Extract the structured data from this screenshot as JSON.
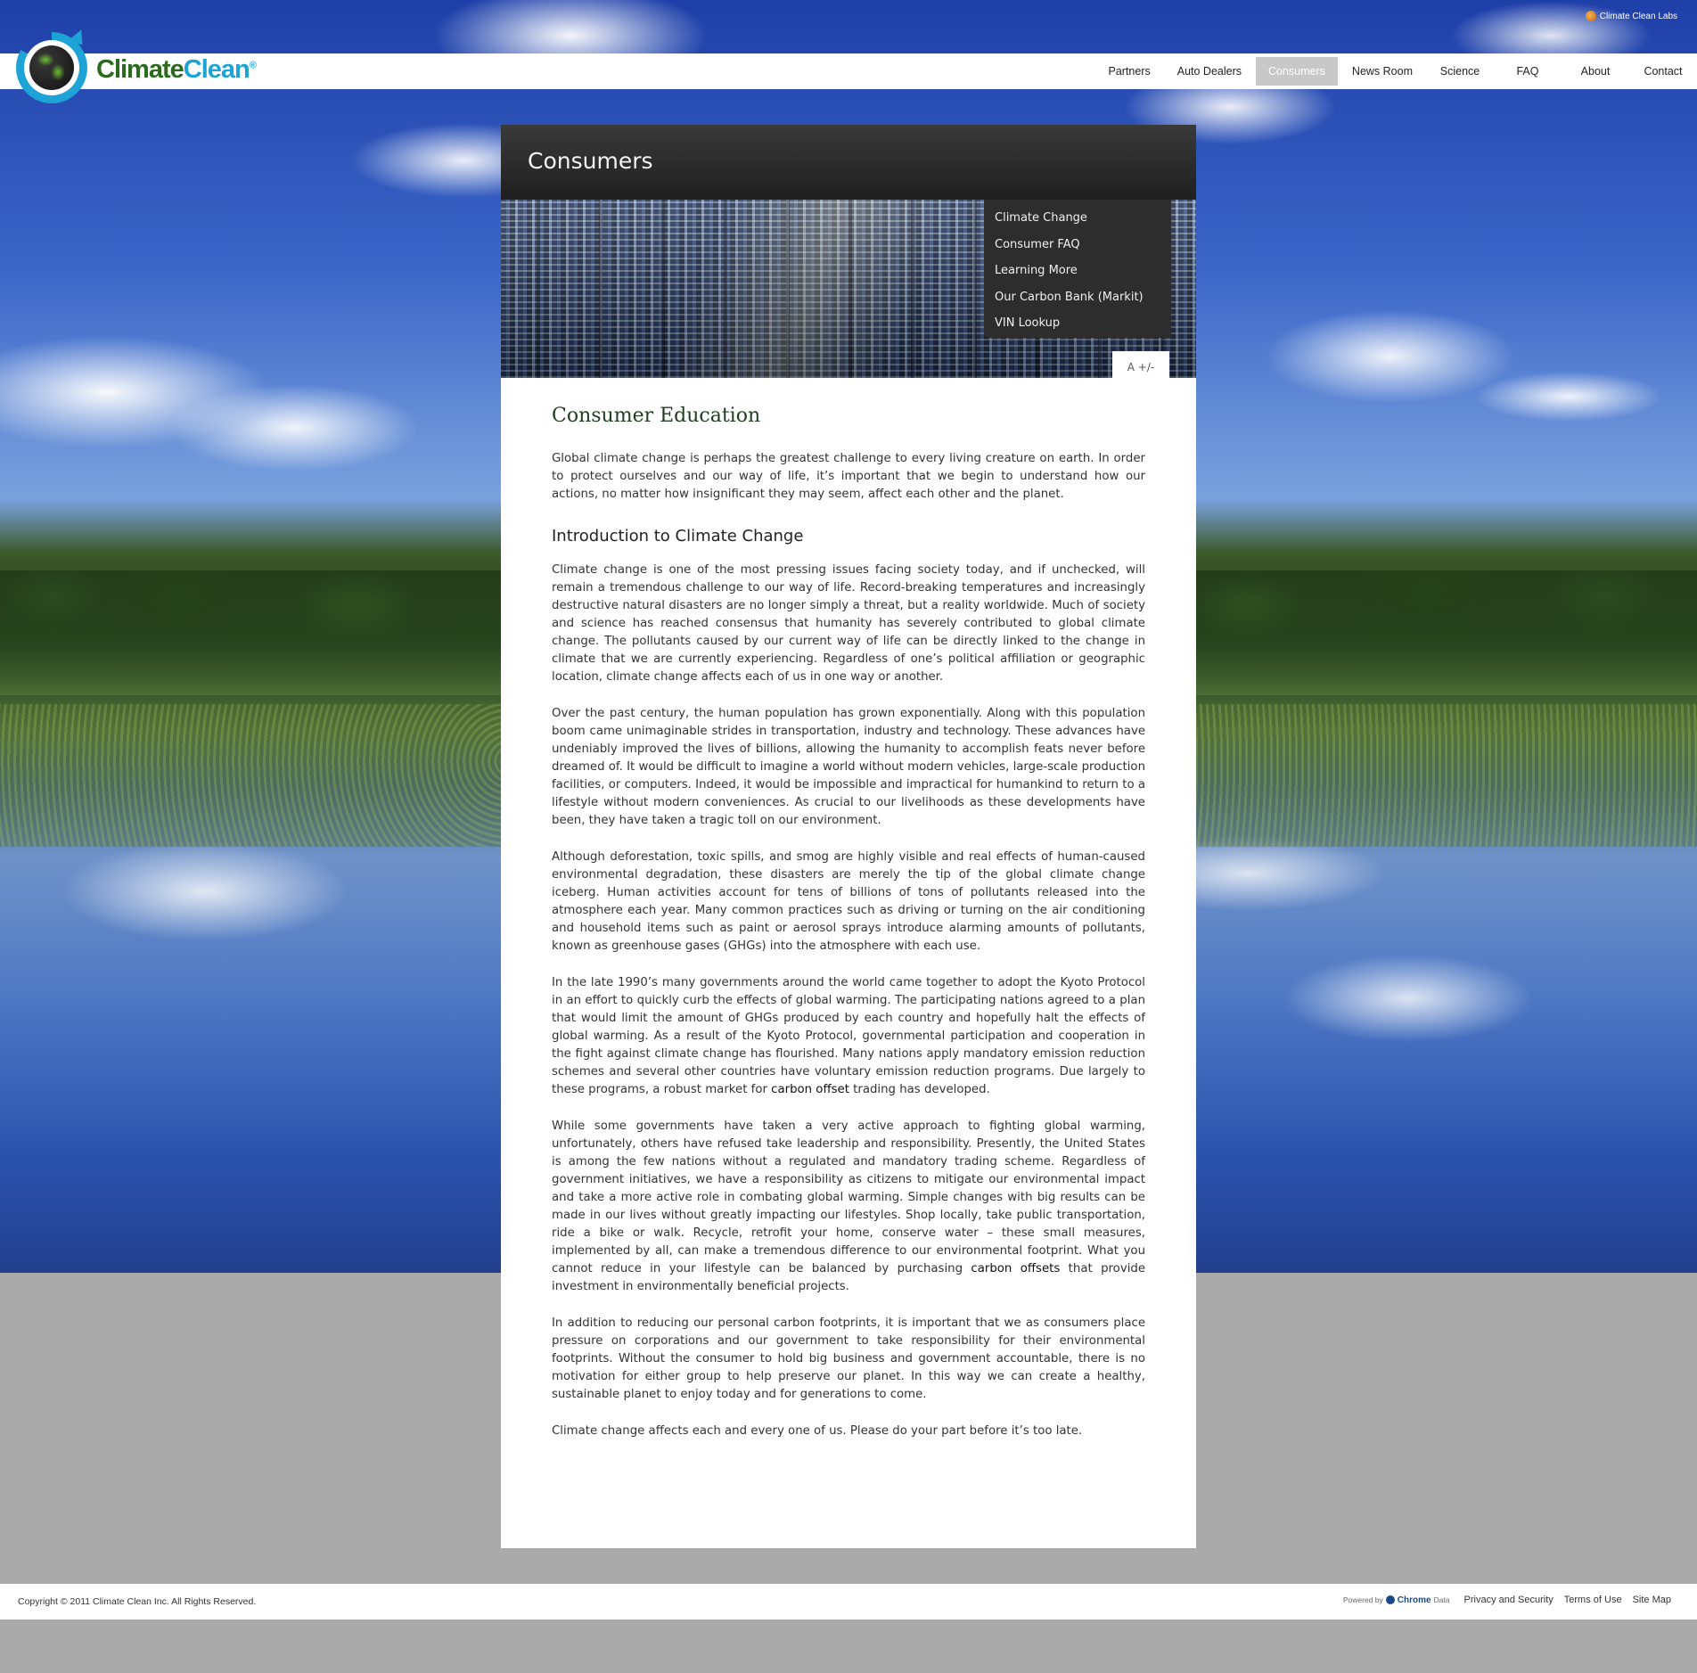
{
  "top_right": {
    "label": "Climate Clean Labs"
  },
  "logo": {
    "word1": "Climate",
    "word2": "Clean",
    "mark": "®"
  },
  "nav": {
    "items": [
      {
        "label": "Partners"
      },
      {
        "label": "Auto Dealers"
      },
      {
        "label": "Consumers",
        "active": true
      },
      {
        "label": "News Room"
      },
      {
        "label": "Science"
      },
      {
        "label": "FAQ"
      },
      {
        "label": "About"
      },
      {
        "label": "Contact"
      }
    ]
  },
  "panel": {
    "title": "Consumers",
    "subnav": [
      {
        "label": "Climate Change"
      },
      {
        "label": "Consumer FAQ"
      },
      {
        "label": "Learning More"
      },
      {
        "label": "Our Carbon Bank (Markit)"
      },
      {
        "label": "VIN Lookup"
      }
    ],
    "font_control": "A +/-"
  },
  "content": {
    "heading": "Consumer Education",
    "intro": "Global climate change is perhaps the greatest challenge to every living creature on earth. In order to protect ourselves and our way of life, it’s important that we begin to understand how our actions, no matter how insignificant they may seem, affect each other and the planet.",
    "subheading": "Introduction to Climate Change",
    "p1": "Climate change is one of the most pressing issues facing society today, and if unchecked, will remain a tremendous challenge to our way of life. Record-breaking temperatures and increasingly destructive natural disasters are no longer simply a threat, but a reality worldwide. Much of society and science has reached consensus that humanity has severely contributed to global climate change. The pollutants caused by our current way of life can be directly linked to the change in climate that we are currently experiencing. Regardless of one’s political affiliation or geographic location, climate change affects each of us in one way or another.",
    "p2": "Over the past century, the human population has grown exponentially. Along with this population boom came unimaginable strides in transportation, industry and technology. These advances have undeniably improved the lives of billions, allowing the humanity to accomplish feats never before dreamed of. It would be difficult to imagine a world without modern vehicles, large-scale production facilities, or computers. Indeed, it would be impossible and impractical for humankind to return to a lifestyle without modern conveniences. As crucial to our livelihoods as these developments have been, they have taken a tragic toll on our environment.",
    "p3": "Although deforestation, toxic spills, and smog are highly visible and real effects of human-caused environmental degradation, these disasters are merely the tip of the global climate change iceberg. Human activities account for tens of billions of tons of pollutants released into the atmosphere each year. Many common practices such as driving or turning on the air conditioning and household items such as paint or aerosol sprays introduce alarming amounts of pollutants, known as greenhouse gases (GHGs) into the atmosphere with each use.",
    "p4_before": "In the late 1990’s many governments around the world came together to adopt the Kyoto Protocol in an effort to quickly curb the effects of global warming. The participating nations agreed to a plan that would limit the amount of GHGs produced by each country and hopefully halt the effects of global warming. As a result of the Kyoto Protocol, governmental participation and cooperation in the fight against climate change has flourished. Many nations apply mandatory emission reduction schemes and several other countries have voluntary emission reduction programs. Due largely to these programs, a robust market for ",
    "p4_link": "carbon offset",
    "p4_after": " trading has developed.",
    "p5_before": "While some governments have taken a very active approach to fighting global warming, unfortunately, others have refused take leadership and responsibility. Presently, the United States is among the few nations without a regulated and mandatory trading scheme. Regardless of government initiatives, we have a responsibility as citizens to mitigate our environmental impact and take a more active role in combating global warming. Simple changes with big results can be made in our lives without greatly impacting our lifestyles. Shop locally, take public transportation, ride a bike or walk. Recycle, retrofit your home, conserve water – these small measures, implemented by all, can make a tremendous difference to our environmental footprint. What you cannot reduce in your lifestyle can be balanced by purchasing ",
    "p5_link": "carbon offsets",
    "p5_after": " that provide investment in environmentally beneficial projects.",
    "p6": "In addition to reducing our personal carbon footprints, it is important that we as consumers place pressure on corporations and our government to take responsibility for their environmental footprints. Without the consumer to hold big business and government accountable, there is no motivation for either group to help preserve our planet. In this way we can create a healthy, sustainable planet to enjoy today and for generations to come.",
    "p7": "Climate change affects each and every one of us. Please do your part before it’s too late."
  },
  "footer": {
    "copyright": "Copyright © 2011 Climate Clean Inc. All Rights Reserved.",
    "powered_by": "Powered by",
    "powered_brand": "Chrome",
    "powered_brand2": "Data",
    "links": [
      {
        "label": "Privacy and Security"
      },
      {
        "label": "Terms of Use"
      },
      {
        "label": "Site Map"
      }
    ]
  }
}
